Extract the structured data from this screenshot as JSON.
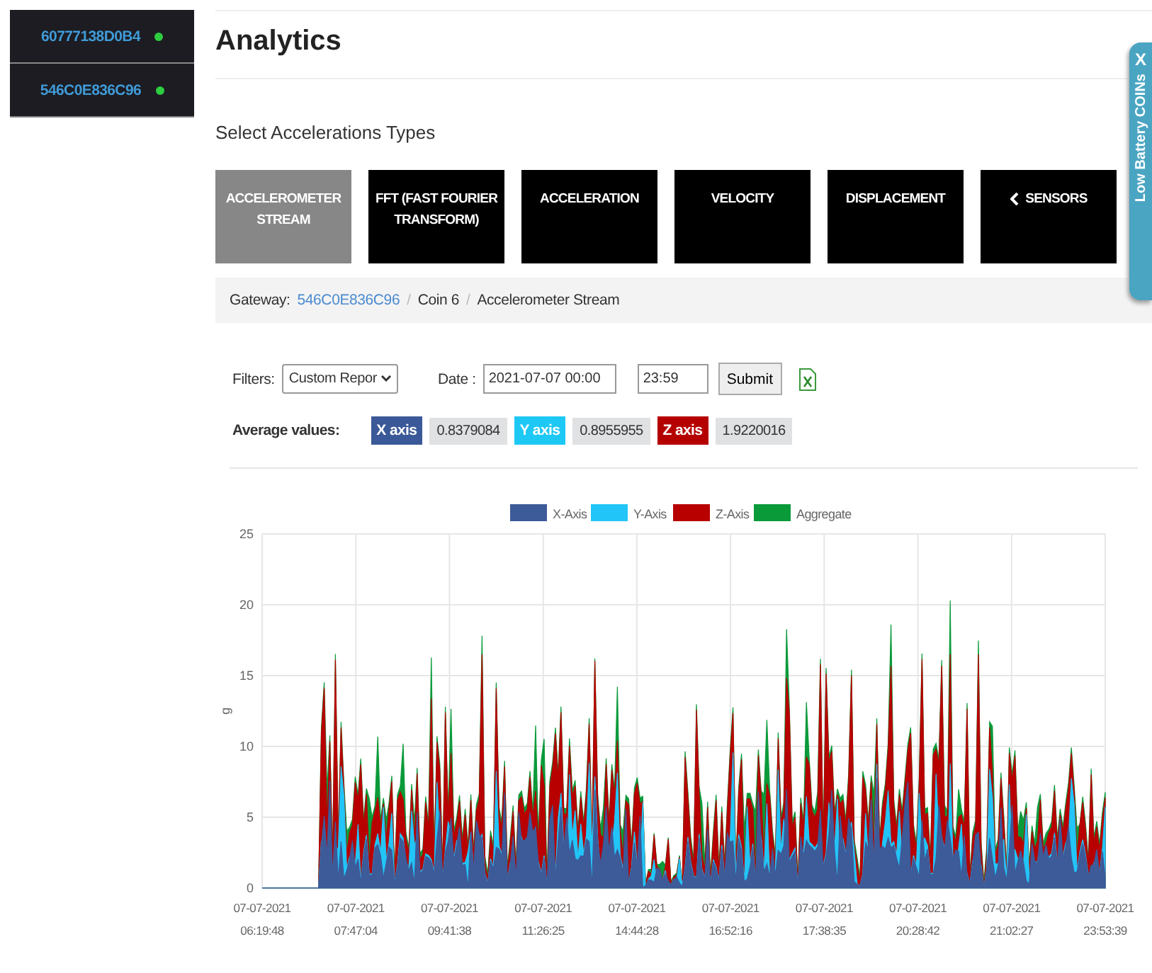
{
  "sidebar": {
    "devices": [
      {
        "id": "60777138D0B4",
        "online": true
      },
      {
        "id": "546C0E836C96",
        "online": true
      }
    ]
  },
  "page_title": "Analytics",
  "section_label": "Select Accelerations Types",
  "type_buttons": [
    {
      "label": "ACCELEROMETER STREAM",
      "selected": true,
      "kind": "type"
    },
    {
      "label": "FFT (FAST FOURIER TRANSFORM)",
      "selected": false,
      "kind": "type"
    },
    {
      "label": "ACCELERATION",
      "selected": false,
      "kind": "type"
    },
    {
      "label": "VELOCITY",
      "selected": false,
      "kind": "type"
    },
    {
      "label": "DISPLACEMENT",
      "selected": false,
      "kind": "type"
    },
    {
      "label": "SENSORS",
      "selected": false,
      "kind": "back"
    }
  ],
  "breadcrumb": {
    "prefix": "Gateway:",
    "link": "546C0E836C96",
    "separator": "/",
    "items": [
      "Coin 6",
      "Accelerometer Stream"
    ]
  },
  "filters": {
    "label": "Filters:",
    "select_value": "Custom Repor",
    "date_label": "Date :",
    "date_value": "2021-07-07 00:00",
    "time_value": "23:59",
    "submit": "Submit"
  },
  "averages": {
    "label": "Average values:",
    "axes": [
      {
        "name": "X axis",
        "value": "0.8379084",
        "color": "#3b5998"
      },
      {
        "name": "Y axis",
        "value": "0.8955955",
        "color": "#1ec8f5"
      },
      {
        "name": "Z axis",
        "value": "1.9220016",
        "color": "#b50000"
      }
    ]
  },
  "chart": {
    "legend": [
      {
        "name": "X-Axis",
        "color": "#3d5a99"
      },
      {
        "name": "Y-Axis",
        "color": "#22c5f7"
      },
      {
        "name": "Z-Axis",
        "color": "#b80000"
      },
      {
        "name": "Aggregate",
        "color": "#0a9a3a"
      }
    ],
    "ylabel": "g",
    "yticks": [
      "25",
      "20",
      "15",
      "10",
      "5",
      "0"
    ],
    "xticks": [
      {
        "date": "07-07-2021",
        "time": "06:19:48"
      },
      {
        "date": "07-07-2021",
        "time": "07:47:04"
      },
      {
        "date": "07-07-2021",
        "time": "09:41:38"
      },
      {
        "date": "07-07-2021",
        "time": "11:26:25"
      },
      {
        "date": "07-07-2021",
        "time": "14:44:28"
      },
      {
        "date": "07-07-2021",
        "time": "16:52:16"
      },
      {
        "date": "07-07-2021",
        "time": "17:38:35"
      },
      {
        "date": "07-07-2021",
        "time": "20:28:42"
      },
      {
        "date": "07-07-2021",
        "time": "21:02:27"
      },
      {
        "date": "07-07-2021",
        "time": "23:53:39"
      }
    ]
  },
  "side_tab": {
    "label": "Low Battery COINs",
    "close": "X"
  }
}
